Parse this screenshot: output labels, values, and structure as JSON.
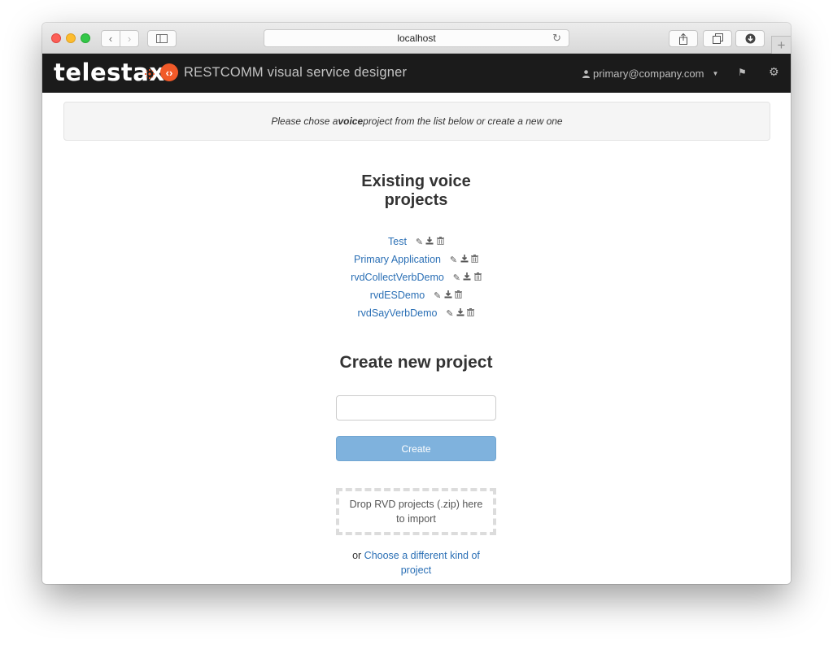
{
  "browser": {
    "url": "localhost",
    "icons": [
      "back-icon",
      "forward-icon",
      "sidebar-icon",
      "reload-icon",
      "share-icon",
      "tabs-icon",
      "download-icon",
      "new-tab-icon"
    ]
  },
  "navbar": {
    "brand": "telestax",
    "app_title": "RESTCOMM visual service designer",
    "user_email": "primary@company.com"
  },
  "alert": {
    "prefix": "Please chose a ",
    "emphasis": "voice",
    "suffix": " project from the list below or create a new one"
  },
  "existing": {
    "title": "Existing voice projects",
    "projects": [
      {
        "name": "Test"
      },
      {
        "name": "Primary Application"
      },
      {
        "name": "rvdCollectVerbDemo"
      },
      {
        "name": "rvdESDemo"
      },
      {
        "name": "rvdSayVerbDemo"
      }
    ]
  },
  "create": {
    "title": "Create new project",
    "input_value": "",
    "button_label": "Create"
  },
  "import": {
    "dropzone_text": "Drop RVD projects (.zip) here to import"
  },
  "other": {
    "prefix": "or ",
    "link": "Choose a different kind of project"
  },
  "colors": {
    "navbar_bg": "#1b1b1b",
    "link": "#2a6fb5",
    "create_button": "#7fb2dd",
    "logo_orange": "#f15a29"
  }
}
